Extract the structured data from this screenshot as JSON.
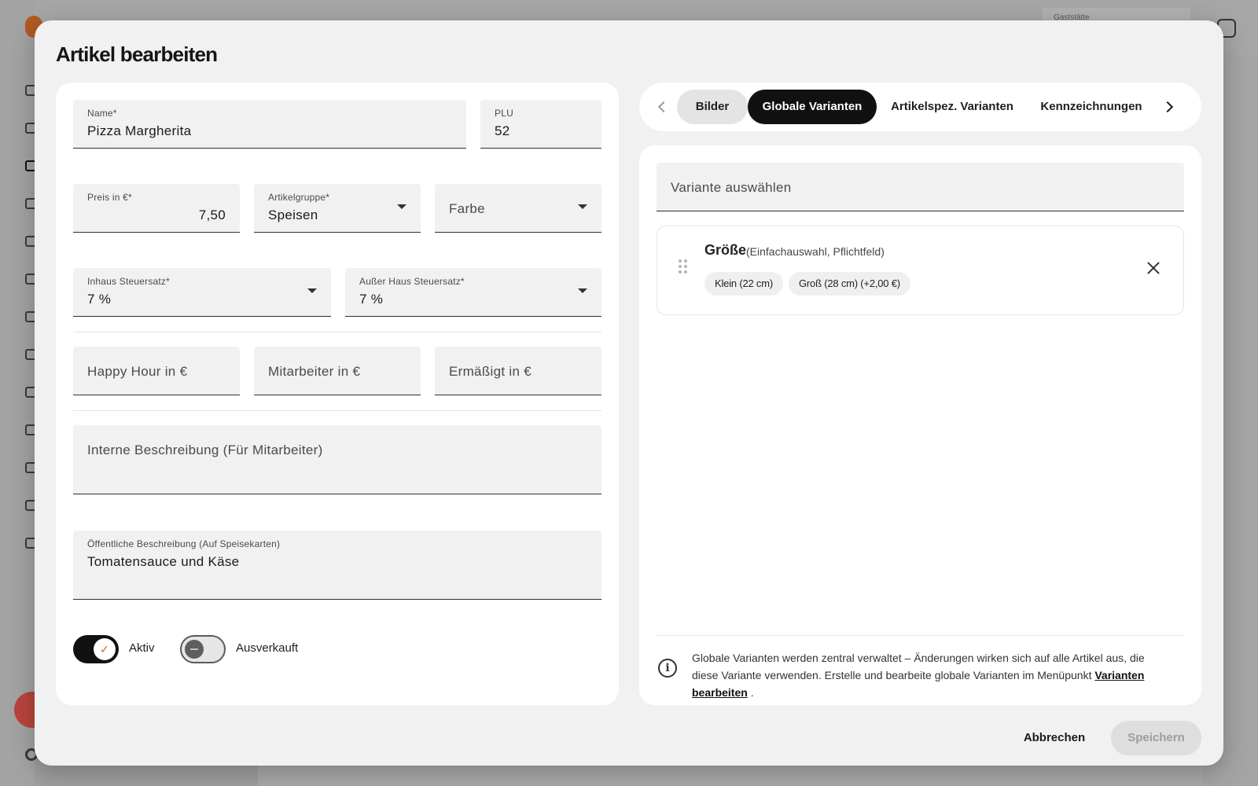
{
  "background": {
    "venue_field_label": "Gaststätte"
  },
  "modal": {
    "title": "Artikel bearbeiten"
  },
  "form": {
    "name": {
      "label": "Name*",
      "value": "Pizza Margherita"
    },
    "plu": {
      "label": "PLU",
      "value": "52"
    },
    "price": {
      "label": "Preis in €*",
      "value": "7,50"
    },
    "article_group": {
      "label": "Artikelgruppe*",
      "value": "Speisen"
    },
    "color": {
      "placeholder": "Farbe"
    },
    "inhouse_tax": {
      "label": "Inhaus Steuersatz*",
      "value": "7 %"
    },
    "takeaway_tax": {
      "label": "Außer Haus Steuersatz*",
      "value": "7 %"
    },
    "happy_hour": {
      "placeholder": "Happy Hour in €"
    },
    "staff_price": {
      "placeholder": "Mitarbeiter in €"
    },
    "reduced_price": {
      "placeholder": "Ermäßigt in €"
    },
    "internal_description": {
      "placeholder": "Interne Beschreibung (Für Mitarbeiter)"
    },
    "public_description": {
      "label": "Öffentliche Beschreibung (Auf Speisekarten)",
      "value": "Tomatensauce und Käse"
    },
    "active_toggle": {
      "label": "Aktiv",
      "checked": true
    },
    "soldout_toggle": {
      "label": "Ausverkauft",
      "checked": false
    }
  },
  "tabs": [
    {
      "label": "Bilder",
      "state": "muted"
    },
    {
      "label": "Globale Varianten",
      "state": "active"
    },
    {
      "label": "Artikelspez. Varianten",
      "state": "default"
    },
    {
      "label": "Kennzeichnungen",
      "state": "default"
    }
  ],
  "variants": {
    "select_placeholder": "Variante auswählen",
    "items": [
      {
        "title": "Größe",
        "subtitle": "(Einfachauswahl, Pflichtfeld)",
        "options": [
          "Klein (22 cm)",
          "Groß (28 cm) (+2,00 €)"
        ]
      }
    ],
    "info_text": "Globale Varianten werden zentral verwaltet – Änderungen wirken sich auf alle Artikel aus, die diese Variante verwenden. Erstelle und bearbeite globale Varianten im Menüpunkt",
    "info_link": "Varianten bearbeiten",
    "info_suffix": "."
  },
  "actions": {
    "cancel_label": "Abbrechen",
    "save_label": "Speichern"
  },
  "colors": {
    "accent_dark": "#111111",
    "surface": "#f1f1f1",
    "card": "#ffffff"
  }
}
